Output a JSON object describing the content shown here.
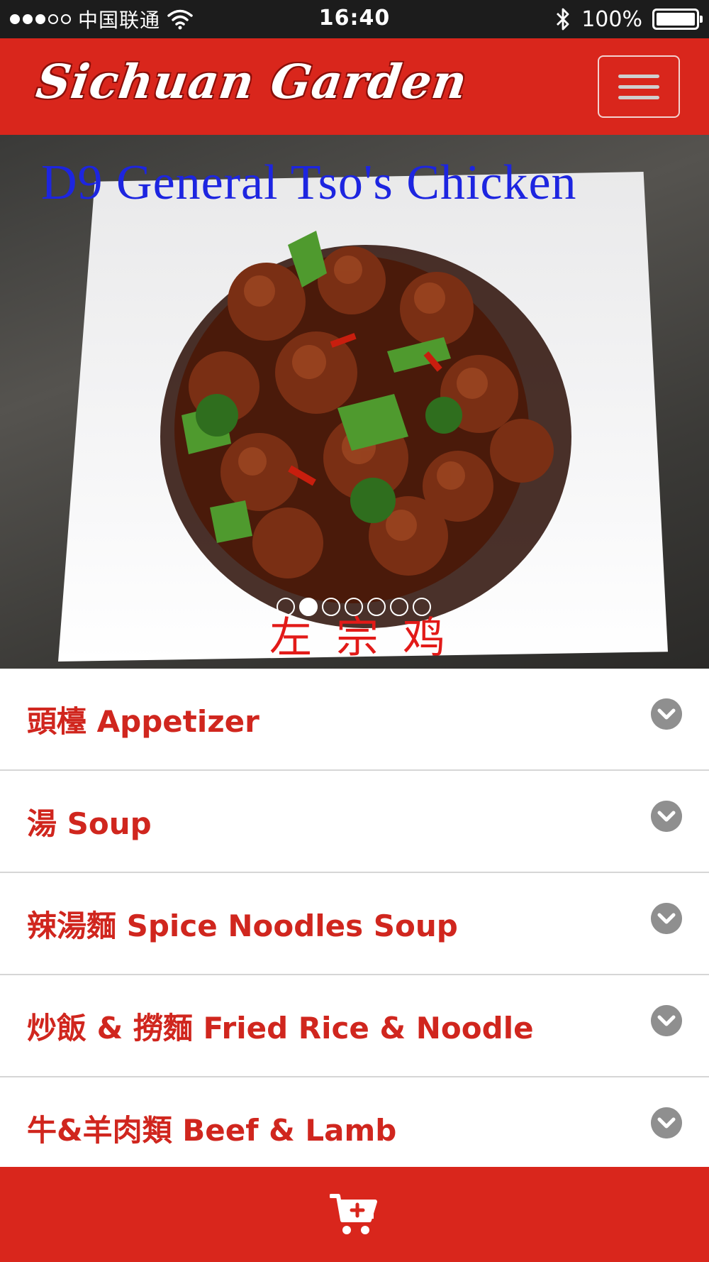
{
  "status_bar": {
    "carrier": "中国联通",
    "time": "16:40",
    "battery": "100%"
  },
  "header": {
    "logo_text": "Sichuan Garden",
    "menu_icon": "hamburger-icon"
  },
  "hero": {
    "title": "D9 General Tso's Chicken",
    "chinese_caption": "左宗鸡",
    "slide_count": 7,
    "active_slide": 2
  },
  "categories": [
    {
      "label": "頭檯 Appetizer"
    },
    {
      "label": "湯 Soup"
    },
    {
      "label": "辣湯麵 Spice Noodles Soup"
    },
    {
      "label": "炒飯 & 撈麵 Fried Rice & Noodle"
    },
    {
      "label": "牛&羊肉類 Beef & Lamb"
    }
  ],
  "bottom_bar": {
    "cart_icon": "add-to-cart-icon"
  },
  "colors": {
    "brand_red": "#d9261c",
    "category_text": "#d0261e",
    "chevron_gray": "#8f8f8f"
  }
}
